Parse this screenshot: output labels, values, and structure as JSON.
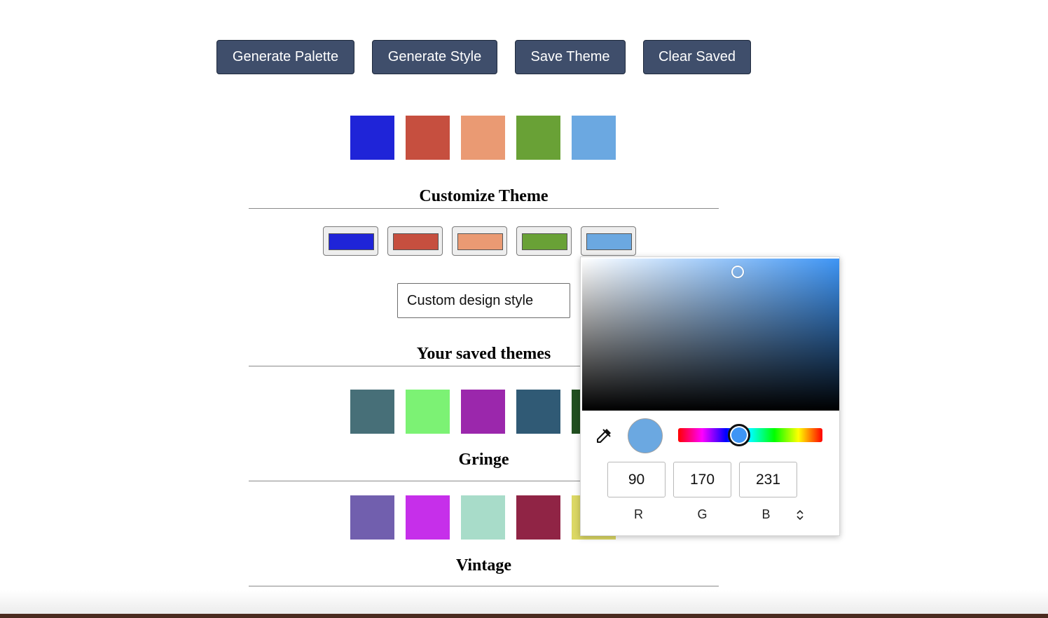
{
  "toolbar": {
    "generate_palette": "Generate Palette",
    "generate_style": "Generate Style",
    "save_theme": "Save Theme",
    "clear_saved": "Clear Saved"
  },
  "palette": {
    "colors": [
      "#1f24d8",
      "#c64f3f",
      "#ea9a73",
      "#69a136",
      "#6ba8e1"
    ]
  },
  "customize": {
    "title": "Customize Theme",
    "color_buttons": [
      "#1f24d8",
      "#c64f3f",
      "#ea9a73",
      "#69a136",
      "#6ba8e1"
    ],
    "style_input_value": "Custom design style"
  },
  "saved": {
    "title": "Your saved themes",
    "themes": [
      {
        "name": "Gringe",
        "colors": [
          "#476f78",
          "#7cf274",
          "#9b27ac",
          "#305a75",
          "#214f1f"
        ]
      },
      {
        "name": "Vintage",
        "colors": [
          "#715fae",
          "#c62fea",
          "#a8dcc9",
          "#902445",
          "#dcd864"
        ]
      }
    ]
  },
  "color_picker": {
    "preview_color": "#6ba8e1",
    "hue_color": "#3e95f5",
    "r": "90",
    "g": "170",
    "b": "231",
    "r_label": "R",
    "g_label": "G",
    "b_label": "B"
  }
}
